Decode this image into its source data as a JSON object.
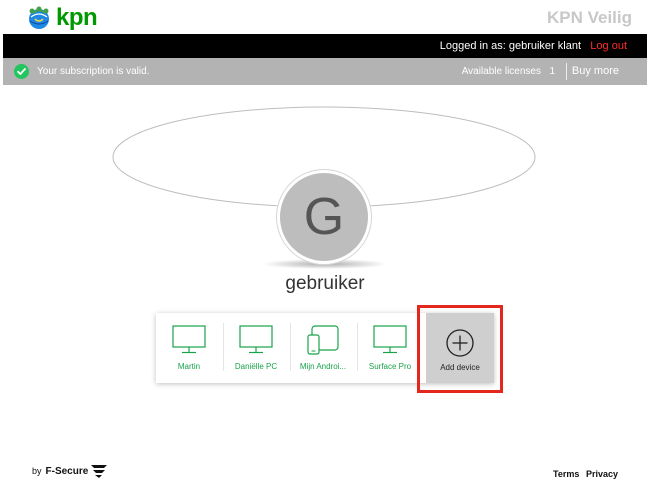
{
  "header": {
    "logo_text": "kpn",
    "app_title": "KPN Veilig"
  },
  "userbar": {
    "logged_in": "Logged in as: gebruiker klant",
    "logout": "Log out"
  },
  "subscription": {
    "message": "Your subscription is valid.",
    "licenses_label": "Available licenses",
    "licenses_count": "1",
    "buy_more": "Buy more"
  },
  "profile": {
    "initial": "G",
    "name": "gebruiker"
  },
  "devices": [
    {
      "label": "Martin",
      "icon": "monitor-icon"
    },
    {
      "label": "Daniëlle PC",
      "icon": "monitor-icon"
    },
    {
      "label": "Mijn Androi...",
      "icon": "tablet-phone-icon"
    },
    {
      "label": "Surface Pro",
      "icon": "monitor-icon"
    }
  ],
  "add_device": {
    "label": "Add device",
    "icon": "plus-circle-icon"
  },
  "footer": {
    "by": "by",
    "brand": "F-Secure",
    "terms": "Terms",
    "privacy": "Privacy"
  },
  "colors": {
    "accent_green": "#18a34a",
    "logout_red": "#ff2a2a",
    "highlight_red": "#e5261d",
    "userbar_bg": "#000000",
    "subbar_bg": "#b3b3b3",
    "title_gray": "#c8c8c8"
  }
}
